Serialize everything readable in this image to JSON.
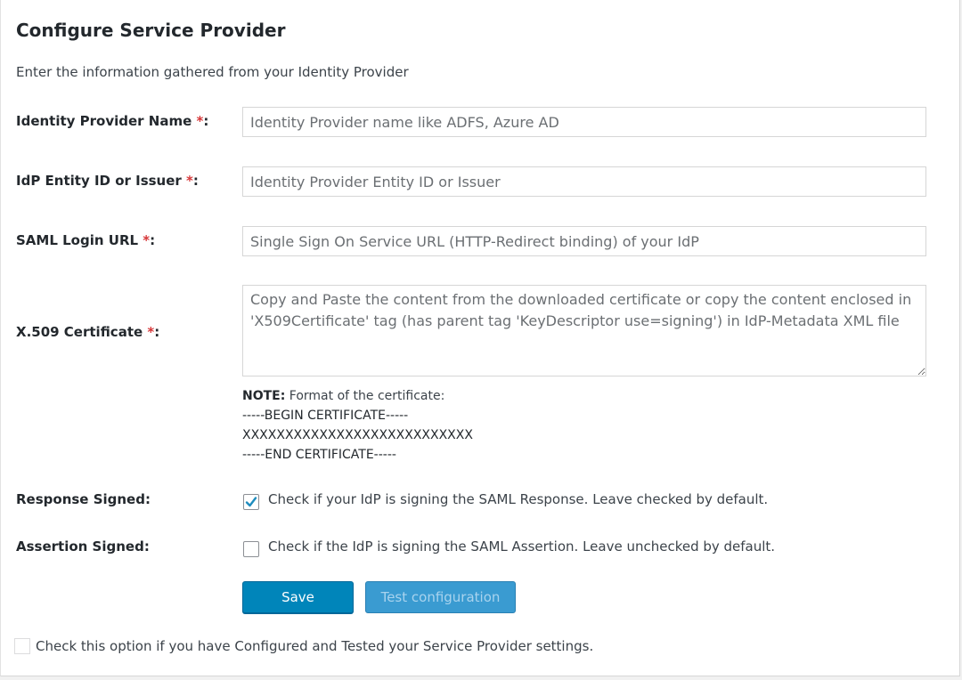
{
  "page": {
    "title": "Configure Service Provider",
    "subtitle": "Enter the information gathered from your Identity Provider"
  },
  "required_marker": "*",
  "fields": {
    "idp_name": {
      "label": "Identity Provider Name ",
      "suffix": ":",
      "value": "",
      "placeholder": "Identity Provider name like ADFS, Azure AD"
    },
    "entity_id": {
      "label": "IdP Entity ID or Issuer ",
      "suffix": ":",
      "value": "",
      "placeholder": "Identity Provider Entity ID or Issuer"
    },
    "login_url": {
      "label": "SAML Login URL ",
      "suffix": ":",
      "value": "",
      "placeholder": "Single Sign On Service URL (HTTP-Redirect binding) of your IdP"
    },
    "certificate": {
      "label": "X.509 Certificate ",
      "suffix": ":",
      "value": "",
      "placeholder": "Copy and Paste the content from the downloaded certificate or copy the content enclosed in 'X509Certificate' tag (has parent tag 'KeyDescriptor use=signing') in IdP-Metadata XML file"
    }
  },
  "note": {
    "prefix": "NOTE:",
    "text": " Format of the certificate:",
    "line1": "-----BEGIN CERTIFICATE-----",
    "line2": "XXXXXXXXXXXXXXXXXXXXXXXXXXX",
    "line3": "-----END CERTIFICATE-----"
  },
  "response_signed": {
    "label": "Response Signed:",
    "checked": true,
    "text": "Check if your IdP is signing the SAML Response. Leave checked by default."
  },
  "assertion_signed": {
    "label": "Assertion Signed:",
    "checked": false,
    "text": "Check if the IdP is signing the SAML Assertion. Leave unchecked by default."
  },
  "buttons": {
    "save": "Save",
    "test": "Test configuration"
  },
  "configured_option": {
    "checked": false,
    "text": "Check this option if you have Configured and Tested your Service Provider settings."
  },
  "colors": {
    "primary_button": "#0085ba",
    "secondary_button": "#3a9bd1",
    "required": "#d63638",
    "checkmark": "#1e8cbe"
  },
  "icons": {
    "response_checkbox": "checkmark-icon"
  }
}
